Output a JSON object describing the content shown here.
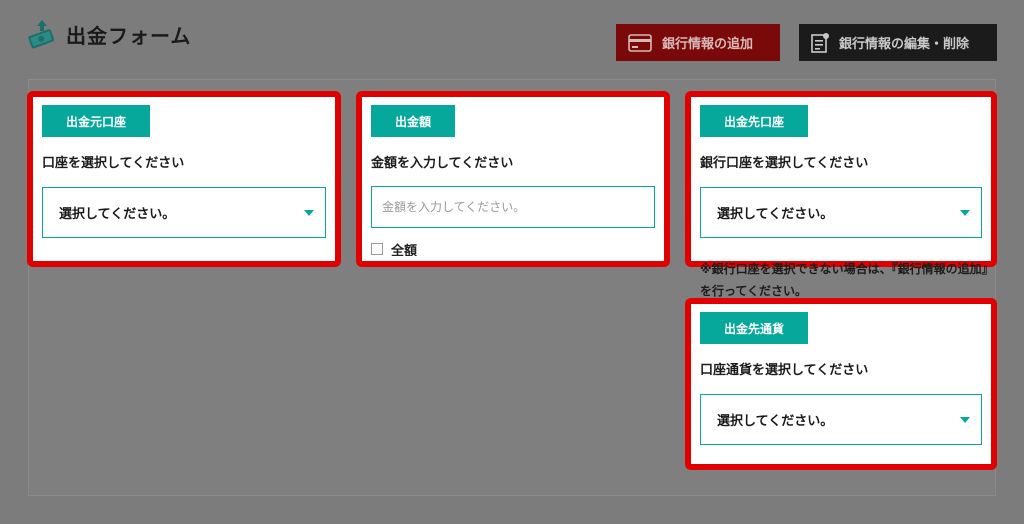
{
  "header": {
    "title": "出金フォーム",
    "title_icon": "money-upload-icon",
    "add_bank_label": "銀行情報の追加",
    "edit_bank_label": "銀行情報の編集・削除",
    "colors": {
      "accent": "#05a89a",
      "add_button": "#7a0a0a",
      "edit_button": "#1b1b1b",
      "highlight": "#e00000"
    }
  },
  "source_account": {
    "tag": "出金元口座",
    "label": "口座を選択してください",
    "selected": "選択してください。"
  },
  "amount": {
    "tag": "出金額",
    "label": "金額を入力してください",
    "placeholder": "金額を入力してください。",
    "all_label": "全額"
  },
  "dest_account": {
    "tag": "出金先口座",
    "label": "銀行口座を選択してください",
    "selected": "選択してください。",
    "note": "※銀行口座を選択できない場合は、『銀行情報の追加』を行ってください。"
  },
  "dest_currency": {
    "tag": "出金先通貨",
    "label": "口座通貨を選択してください",
    "selected": "選択してください。"
  }
}
